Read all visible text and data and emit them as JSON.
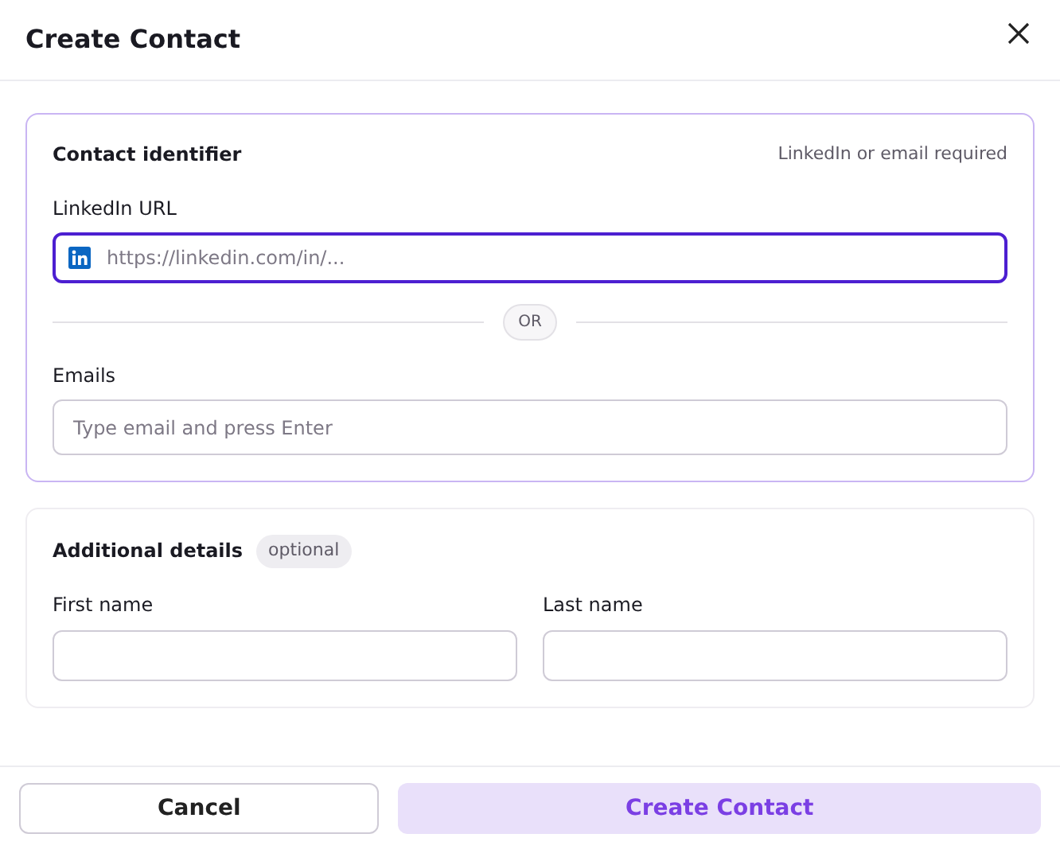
{
  "dialog": {
    "title": "Create Contact"
  },
  "identifier_section": {
    "title": "Contact identifier",
    "hint": "LinkedIn or email required",
    "linkedin": {
      "label": "LinkedIn URL",
      "placeholder": "https://linkedin.com/in/...",
      "focused": true
    },
    "separator": "OR",
    "emails": {
      "label": "Emails",
      "placeholder": "Type email and press Enter",
      "focused": false
    }
  },
  "details_section": {
    "title": "Additional details",
    "badge": "optional",
    "fields": [
      {
        "label": "First name"
      },
      {
        "label": "Last name"
      }
    ]
  },
  "buttons": [
    {
      "label": "Cancel",
      "kind": "secondary",
      "disabled": false
    },
    {
      "label": "Create Contact",
      "kind": "primary",
      "disabled": true
    }
  ]
}
